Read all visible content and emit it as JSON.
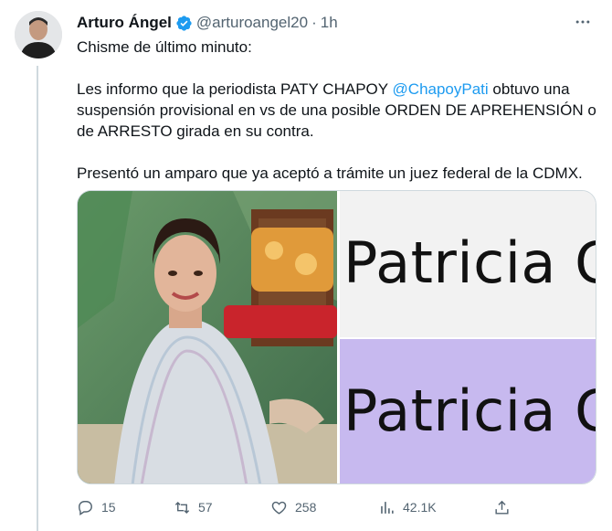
{
  "tweet": {
    "author_name": "Arturo Ángel",
    "handle": "@arturoangel20",
    "separator": "·",
    "time": "1h",
    "lines": [
      "Chisme de último minuto:",
      "Les informo que la periodista PATY CHAPOY",
      "@ChapoyPati",
      "obtuvo una suspensión provisional en vs de una posible ORDEN DE APREHENSIÓN o de ARRESTO girada en su contra.",
      "Presentó un amparo que ya aceptó a trámite un juez federal de la CDMX."
    ]
  },
  "media": {
    "right_top_text": "Patricia C",
    "right_bottom_text": "Patricia C",
    "right_bottom_color": "#c7b9ef"
  },
  "actions": {
    "replies": "15",
    "retweets": "57",
    "likes": "258",
    "views": "42.1K"
  },
  "icons": [
    "verified-badge-icon",
    "more-icon",
    "reply-icon",
    "retweet-icon",
    "like-icon",
    "views-icon",
    "share-icon"
  ],
  "colors": {
    "accent": "#1d9bf0",
    "secondary_text": "#536471"
  }
}
